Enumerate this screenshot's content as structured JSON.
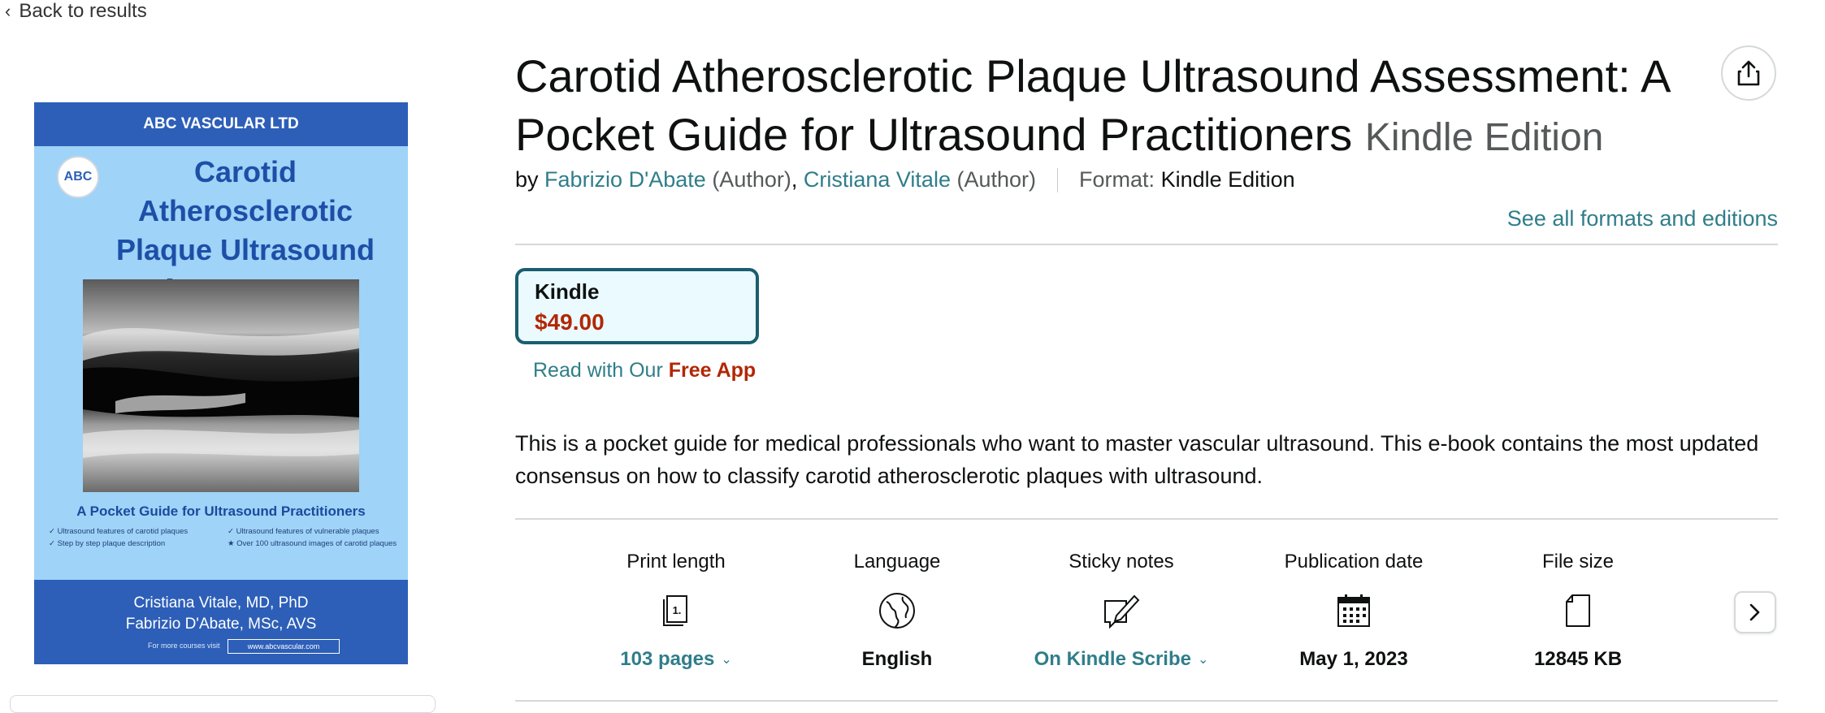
{
  "nav": {
    "back_label": "Back to results"
  },
  "cover": {
    "publisher": "ABC VASCULAR LTD",
    "emblem": "ABC",
    "title_line1": "Carotid Atherosclerotic",
    "title_line2": "Plaque Ultrasound",
    "title_line3": "Assessment",
    "subtitle": "A Pocket Guide for Ultrasound Practitioners",
    "bullets": [
      "✓ Ultrasound features of carotid plaques",
      "✓ Ultrasound features of vulnerable plaques",
      "✓ Step by step plaque description",
      "★ Over 100 ultrasound images of carotid plaques"
    ],
    "author1": "Cristiana Vitale, MD, PhD",
    "author2": "Fabrizio D'Abate, MSc, AVS",
    "visit_text": "For more courses visit",
    "url": "www.abcvascular.com",
    "colors": {
      "band": "#2d5fb8",
      "background": "#9fd3f7",
      "title": "#1d4fa8"
    }
  },
  "product": {
    "title": "Carotid Atherosclerotic Plaque Ultrasound Assessment: A Pocket Guide for Ultrasound Practitioners",
    "edition": "Kindle Edition",
    "by": "by",
    "authors": [
      {
        "name": "Fabrizio D'Abate",
        "role": "(Author)"
      },
      {
        "name": "Cristiana Vitale",
        "role": "(Author)"
      }
    ],
    "format_label": "Format:",
    "format_value": "Kindle Edition",
    "see_all": "See all formats and editions",
    "share_icon": "share-icon"
  },
  "swatch": {
    "label": "Kindle",
    "price": "$49.00",
    "read_prefix": "Read with Our",
    "read_app": "Free App"
  },
  "description": "This is a pocket guide for medical professionals who want to master vascular ultrasound. This e-book contains the most updated consensus on how to classify carotid atherosclerotic plaques with ultrasound.",
  "details": [
    {
      "label": "Print length",
      "icon": "book-pages-icon",
      "value": "103 pages",
      "link": true
    },
    {
      "label": "Language",
      "icon": "globe-icon",
      "value": "English",
      "link": false
    },
    {
      "label": "Sticky notes",
      "icon": "pen-note-icon",
      "value": "On Kindle Scribe",
      "link": true
    },
    {
      "label": "Publication date",
      "icon": "calendar-icon",
      "value": "May 1, 2023",
      "link": false
    },
    {
      "label": "File size",
      "icon": "file-icon",
      "value": "12845 KB",
      "link": false
    }
  ],
  "colors": {
    "link": "#2f7e8a",
    "price": "#b12704",
    "swatch_border": "#1a5e6e"
  }
}
